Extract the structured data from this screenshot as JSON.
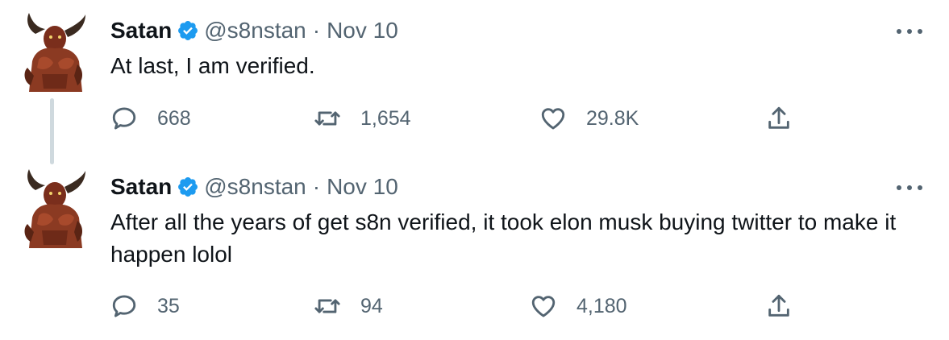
{
  "tweets": [
    {
      "name": "Satan",
      "handle": "@s8nstan",
      "separator": "·",
      "date": "Nov 10",
      "text": "At last, I am verified.",
      "replies": "668",
      "retweets": "1,654",
      "likes": "29.8K"
    },
    {
      "name": "Satan",
      "handle": "@s8nstan",
      "separator": "·",
      "date": "Nov 10",
      "text": "After all the years of get s8n verified, it took elon musk buying twitter to make it happen lolol",
      "replies": "35",
      "retweets": "94",
      "likes": "4,180"
    }
  ],
  "colors": {
    "verified_badge": "#1d9bf0",
    "muted_text": "#536471",
    "thread_line": "#cfd9de"
  },
  "icons": [
    "verified-badge-icon",
    "more-icon",
    "reply-icon",
    "retweet-icon",
    "like-icon",
    "share-icon"
  ]
}
